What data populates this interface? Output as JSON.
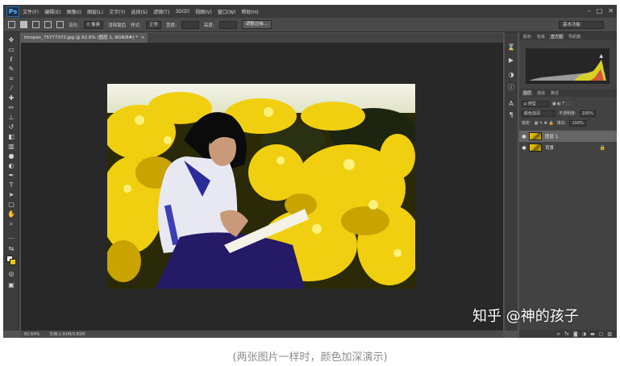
{
  "app": {
    "logo": "Ps",
    "menu": [
      "文件(F)",
      "编辑(E)",
      "图像(I)",
      "图层(L)",
      "文字(Y)",
      "选择(S)",
      "滤镜(T)",
      "3D(D)",
      "视图(V)",
      "窗口(W)",
      "帮助(H)"
    ],
    "window_controls": [
      "–",
      "□",
      "✕"
    ]
  },
  "options_bar": {
    "feather_label": "羽化:",
    "feather_value": "0 像素",
    "antialias_label": "消除锯齿",
    "style_label": "样式:",
    "style_value": "正常",
    "width_label": "宽度:",
    "height_label": "高度:",
    "refine_edge_button": "调整边缘...",
    "workspace": "基本功能"
  },
  "document": {
    "tab_title": "tmopen_75777372.jpg @ 82.6% (图层 1, RGB/8#) *",
    "tab_close": "×"
  },
  "status_bar": {
    "zoom": "82.64%",
    "doc_size": "文档:1.91M/3.81M"
  },
  "panels": {
    "top_tabs": [
      "颜色",
      "色板",
      "直方图",
      "导航器"
    ],
    "active_top_tab": "直方图",
    "layer_tabs": [
      "图层",
      "通道",
      "路径"
    ],
    "active_layer_tab": "图层",
    "kind_filter": "ρ 类型",
    "blend_mode": "颜色加深",
    "opacity_label": "不透明度:",
    "opacity_value": "100%",
    "lock_label": "锁定:",
    "fill_label": "填充:",
    "fill_value": "100%",
    "layers": [
      {
        "name": "图层 1",
        "selected": true,
        "locked": false
      },
      {
        "name": "背景",
        "selected": false,
        "locked": true
      }
    ],
    "footer_icons": [
      "link-icon",
      "fx-icon",
      "mask-icon",
      "adjustment-icon",
      "folder-icon",
      "new-layer-icon",
      "trash-icon"
    ]
  },
  "watermark": "知乎 @神的孩子",
  "caption": "(两张图片一样时，颜色加深演示)",
  "colors": {
    "ps_background": "#535353",
    "canvas_background": "#282828",
    "foreground_swatch": "#ffffff",
    "background_swatch": "#e6c800"
  }
}
